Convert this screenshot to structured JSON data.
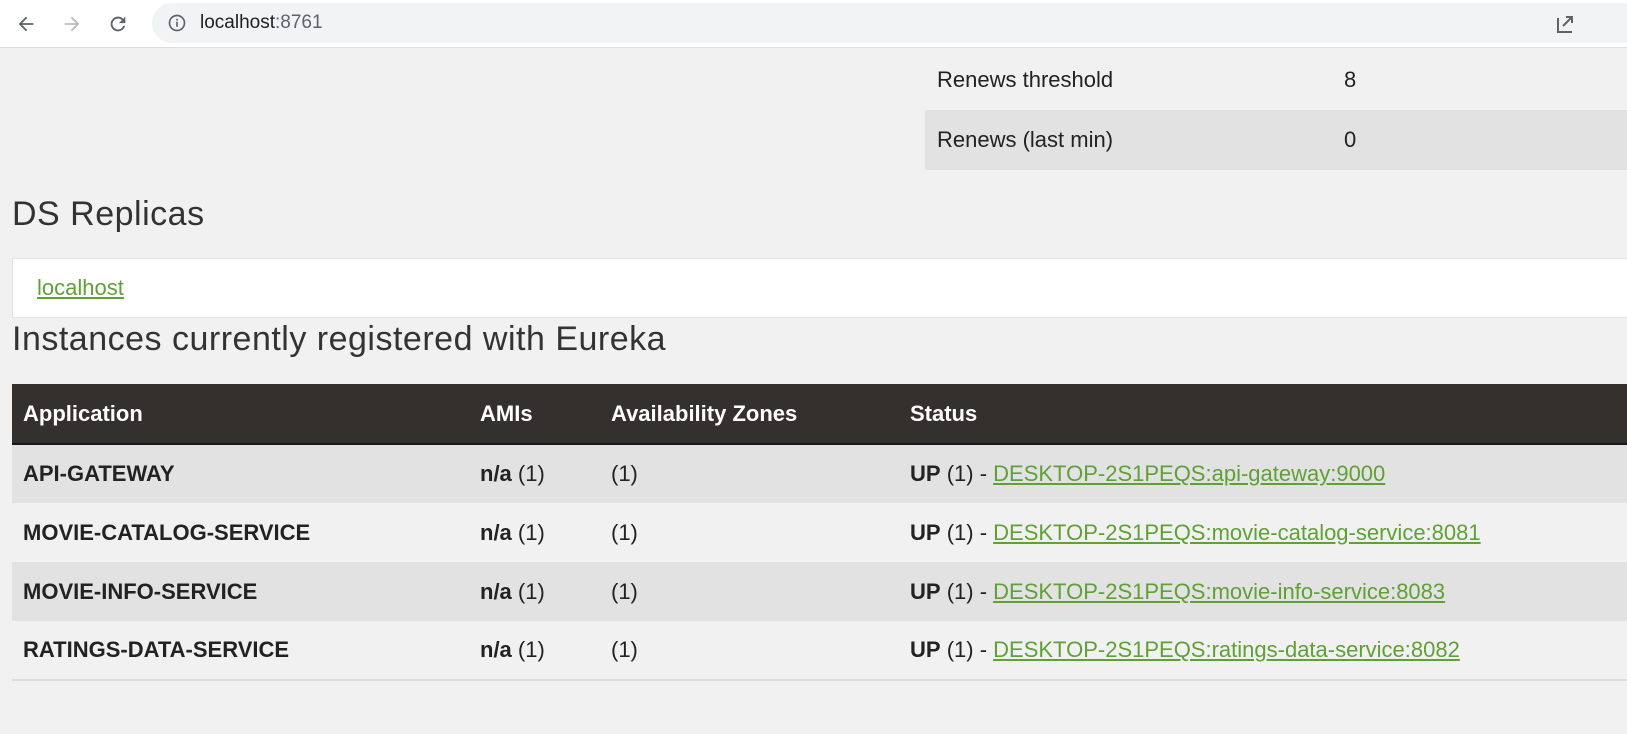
{
  "browser": {
    "url_host": "localhost",
    "url_port": ":8761"
  },
  "renews": [
    {
      "label": "Renews threshold",
      "value": "8"
    },
    {
      "label": "Renews (last min)",
      "value": "0"
    }
  ],
  "replicas": {
    "title": "DS Replicas",
    "link": "localhost"
  },
  "instances": {
    "title": "Instances currently registered with Eureka",
    "headers": [
      "Application",
      "AMIs",
      "Availability Zones",
      "Status"
    ],
    "rows": [
      {
        "app": "API-GATEWAY",
        "amis": "n/a",
        "amis_count": "(1)",
        "zones": "(1)",
        "status": "UP",
        "status_count": "(1) -",
        "instance": "DESKTOP-2S1PEQS:api-gateway:9000"
      },
      {
        "app": "MOVIE-CATALOG-SERVICE",
        "amis": "n/a",
        "amis_count": "(1)",
        "zones": "(1)",
        "status": "UP",
        "status_count": "(1) -",
        "instance": "DESKTOP-2S1PEQS:movie-catalog-service:8081"
      },
      {
        "app": "MOVIE-INFO-SERVICE",
        "amis": "n/a",
        "amis_count": "(1)",
        "zones": "(1)",
        "status": "UP",
        "status_count": "(1) -",
        "instance": "DESKTOP-2S1PEQS:movie-info-service:8083"
      },
      {
        "app": "RATINGS-DATA-SERVICE",
        "amis": "n/a",
        "amis_count": "(1)",
        "zones": "(1)",
        "status": "UP",
        "status_count": "(1) -",
        "instance": "DESKTOP-2S1PEQS:ratings-data-service:8082"
      }
    ]
  },
  "colors": {
    "link": "#5fa134",
    "header_bg": "#34302d"
  }
}
